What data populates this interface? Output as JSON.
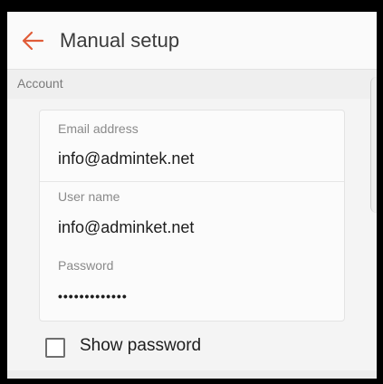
{
  "appbar": {
    "title": "Manual setup",
    "back_icon": "back-arrow-icon",
    "accent_color": "#e05c38"
  },
  "section": {
    "label": "Account"
  },
  "form": {
    "email": {
      "label": "Email address",
      "value": "info@admintek.net"
    },
    "username": {
      "label": "User name",
      "value": "info@adminket.net"
    },
    "password": {
      "label": "Password",
      "value": "•••••••••••••"
    }
  },
  "show_password": {
    "label": "Show password",
    "checked": false
  }
}
